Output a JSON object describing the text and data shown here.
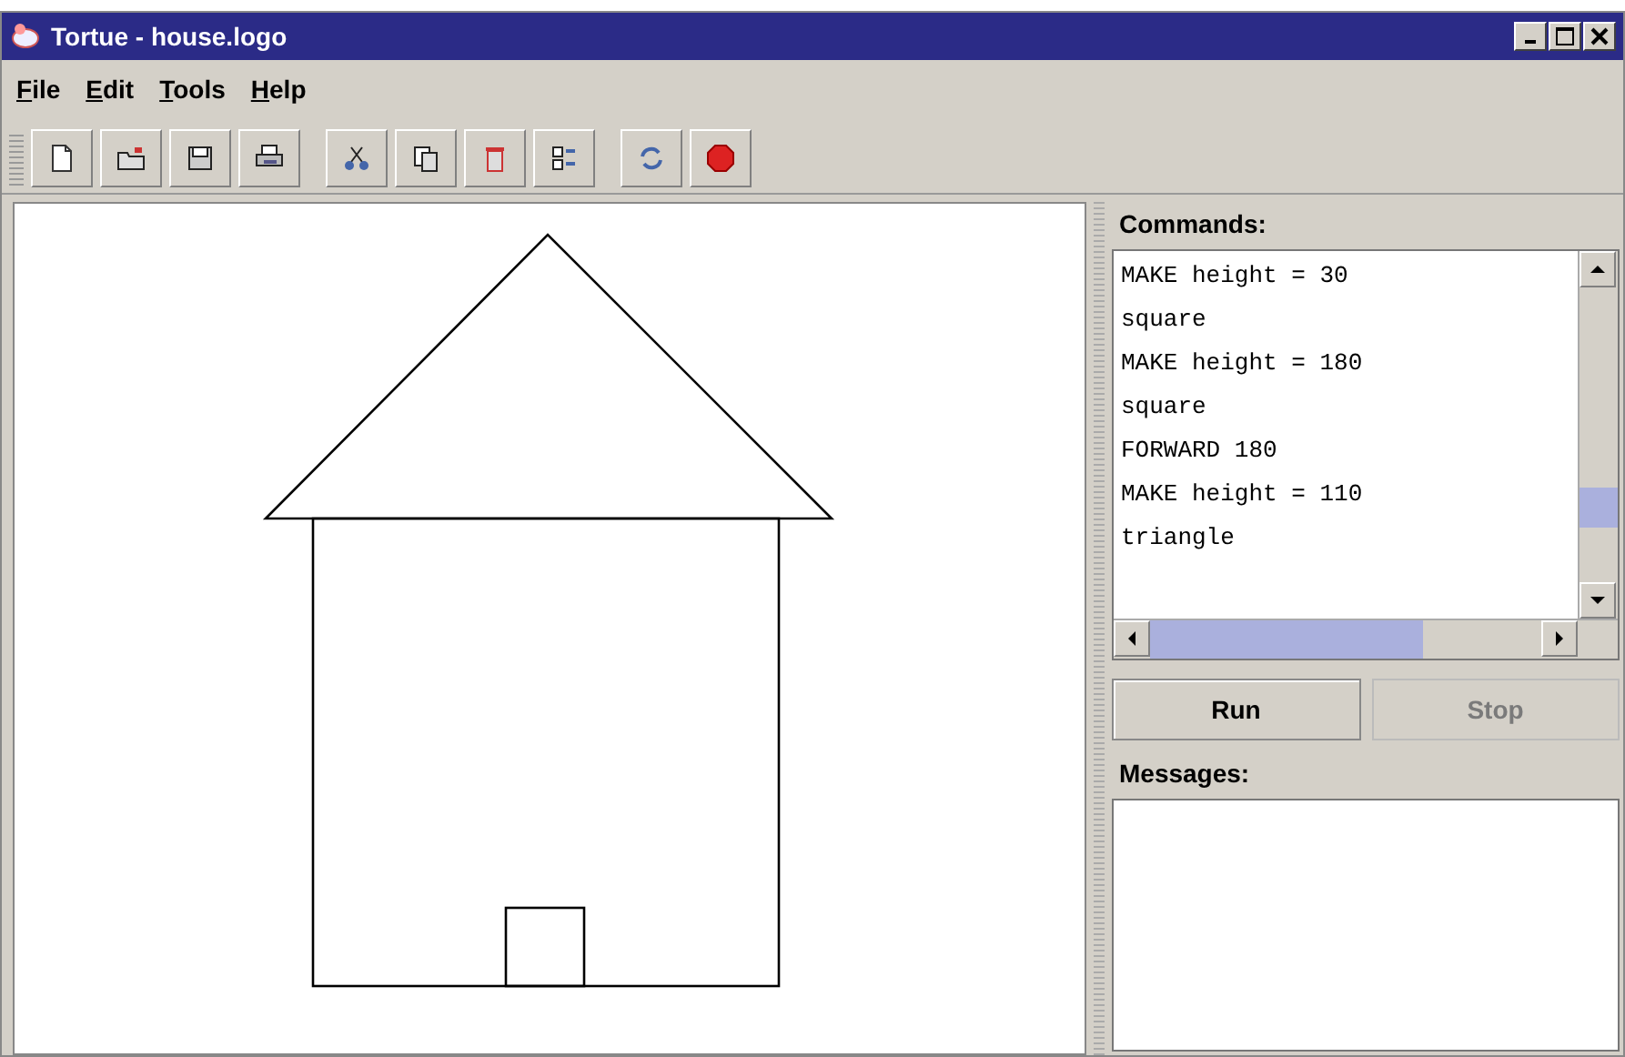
{
  "window": {
    "title": "Tortue - house.logo"
  },
  "menu": [
    {
      "label": "File"
    },
    {
      "label": "Edit"
    },
    {
      "label": "Tools"
    },
    {
      "label": "Help"
    }
  ],
  "toolbar": [
    [
      {
        "kind": "new"
      },
      {
        "kind": "open"
      },
      {
        "kind": "save"
      },
      {
        "kind": "print"
      }
    ],
    [
      {
        "kind": "cut"
      },
      {
        "kind": "copy"
      },
      {
        "kind": "delete"
      },
      {
        "kind": "list"
      }
    ],
    [
      {
        "kind": "refresh"
      },
      {
        "kind": "stop"
      }
    ]
  ],
  "commands": {
    "label": "Commands:",
    "lines": [
      "MAKE height = 30",
      "square",
      "MAKE height = 180",
      "square",
      "FORWARD 180",
      "MAKE height = 110",
      "triangle"
    ]
  },
  "buttons": [
    {
      "label": "Run",
      "disabled": false
    },
    {
      "label": "Stop",
      "disabled": true
    }
  ],
  "messages": {
    "label": "Messages:"
  }
}
